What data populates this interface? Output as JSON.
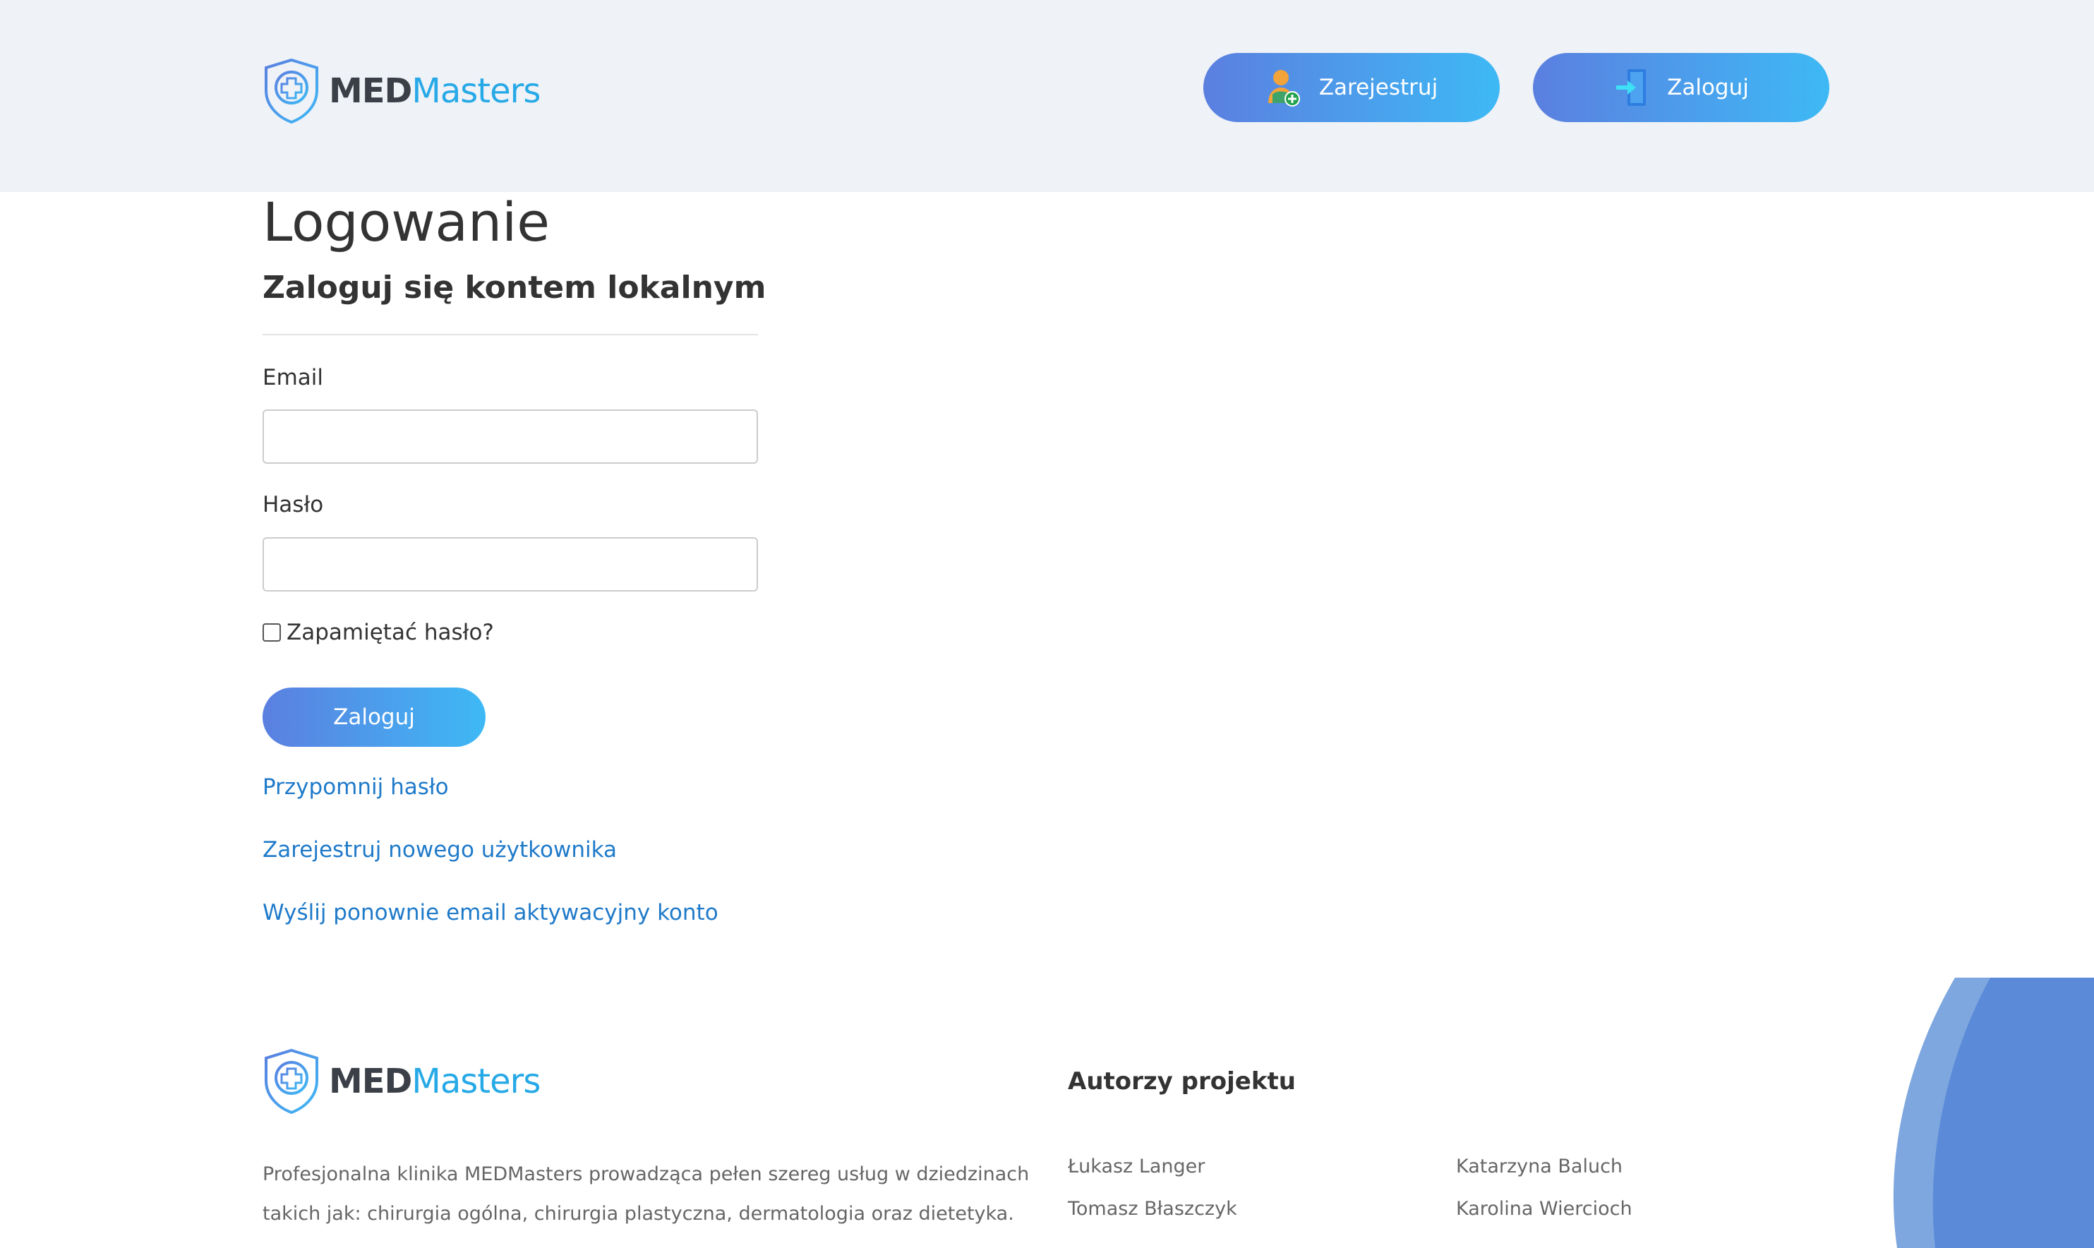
{
  "colors": {
    "brand_dark": "#3b3f47",
    "brand_accent": "#26a9e6",
    "gradient_start": "#5b7fe0",
    "gradient_end": "#3eb9f5",
    "link": "#1f7ac9",
    "header_bg": "#eff2f7"
  },
  "header": {
    "logo": {
      "part1": "MED",
      "part2": "Masters",
      "icon": "shield-cross-icon"
    },
    "register_button": {
      "label": "Zarejestruj",
      "icon": "add-user-icon"
    },
    "login_button": {
      "label": "Zaloguj",
      "icon": "login-door-icon"
    }
  },
  "main": {
    "title": "Logowanie",
    "subtitle": "Zaloguj się kontem lokalnym",
    "email": {
      "label": "Email",
      "value": "",
      "placeholder": ""
    },
    "password": {
      "label": "Hasło",
      "value": "",
      "placeholder": ""
    },
    "remember": {
      "label": "Zapamiętać hasło?",
      "checked": false
    },
    "submit_label": "Zaloguj",
    "links": {
      "forgot": "Przypomnij hasło",
      "register": "Zarejestruj nowego użytkownika",
      "resend": "Wyślij ponownie email aktywacyjny konto"
    }
  },
  "footer": {
    "logo": {
      "part1": "MED",
      "part2": "Masters"
    },
    "about": "Profesjonalna klinika MEDMasters prowadząca pełen szereg usług w dziedzinach takich jak: chirurgia ogólna, chirurgia plastyczna, dermatologia oraz dietetyka.",
    "authors_title": "Autorzy projektu",
    "authors": [
      "Łukasz Langer",
      "Katarzyna Baluch",
      "Tomasz Błaszczyk",
      "Karolina Wiercioch"
    ]
  }
}
